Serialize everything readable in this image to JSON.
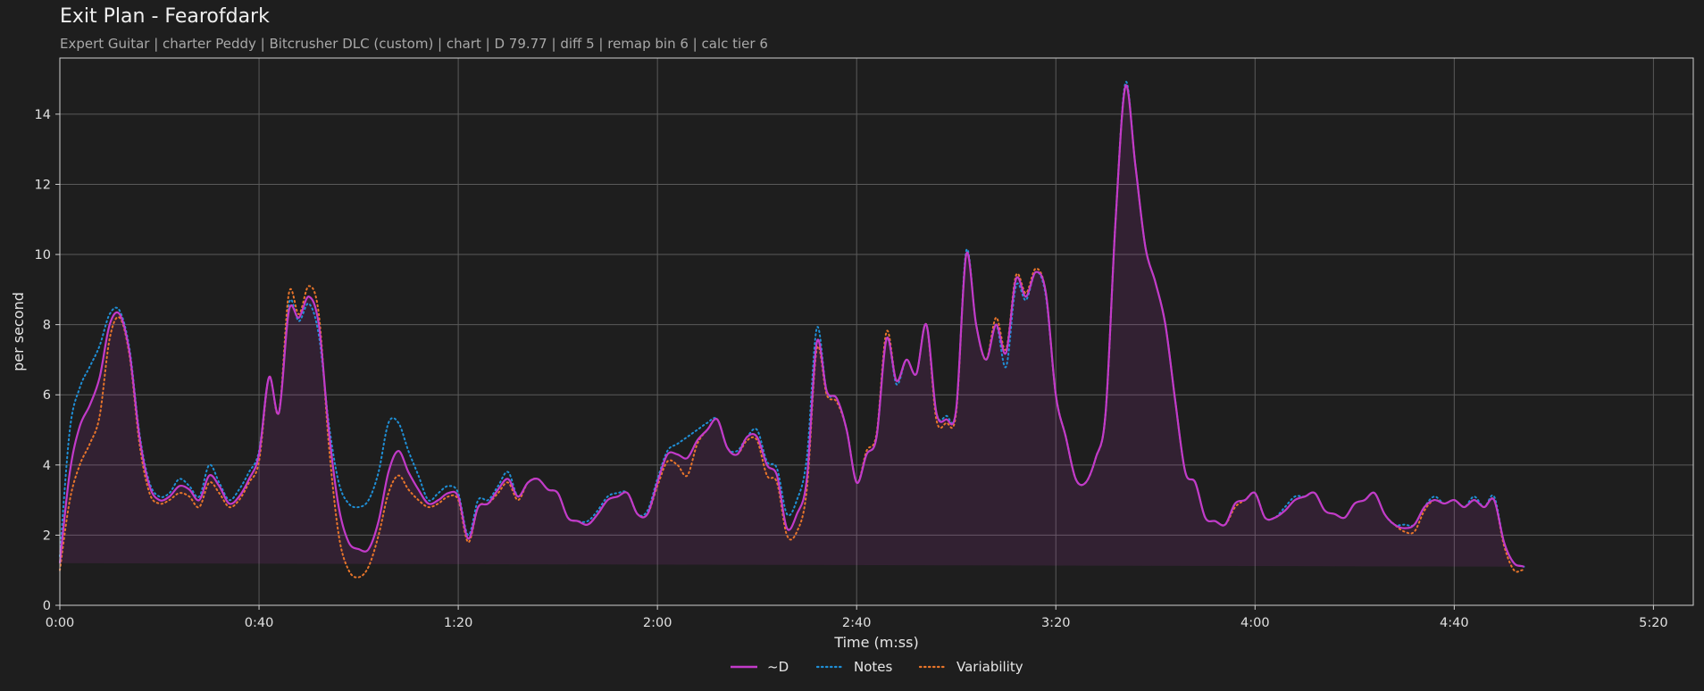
{
  "header": {
    "title": "Exit Plan - Fearofdark",
    "subtitle": "Expert Guitar  |  charter Peddy  |  Bitcrusher DLC (custom)  |  chart  |  D 79.77  |  diff 5  |  remap bin 6  |  calc tier 6"
  },
  "chart_data": {
    "type": "line",
    "title": "Exit Plan - Fearofdark",
    "xlabel": "Time (m:ss)",
    "ylabel": "per second",
    "xlim": [
      0,
      328
    ],
    "ylim": [
      0,
      15.6
    ],
    "grid": true,
    "legend_position": "bottom-center",
    "x_ticks": [
      {
        "value": 0,
        "label": "0:00"
      },
      {
        "value": 40,
        "label": "0:40"
      },
      {
        "value": 80,
        "label": "1:20"
      },
      {
        "value": 120,
        "label": "2:00"
      },
      {
        "value": 160,
        "label": "2:40"
      },
      {
        "value": 200,
        "label": "3:20"
      },
      {
        "value": 240,
        "label": "4:00"
      },
      {
        "value": 280,
        "label": "4:40"
      },
      {
        "value": 320,
        "label": "5:20"
      }
    ],
    "y_ticks": [
      {
        "value": 0,
        "label": "0"
      },
      {
        "value": 2,
        "label": "2"
      },
      {
        "value": 4,
        "label": "4"
      },
      {
        "value": 6,
        "label": "6"
      },
      {
        "value": 8,
        "label": "8"
      },
      {
        "value": 10,
        "label": "10"
      },
      {
        "value": 12,
        "label": "12"
      },
      {
        "value": 14,
        "label": "14"
      }
    ],
    "x": [
      0,
      2,
      4,
      6,
      8,
      10,
      12,
      14,
      16,
      18,
      20,
      22,
      24,
      26,
      28,
      30,
      32,
      34,
      36,
      38,
      40,
      42,
      44,
      46,
      48,
      50,
      52,
      54,
      56,
      58,
      60,
      62,
      64,
      66,
      68,
      70,
      72,
      74,
      76,
      78,
      80,
      82,
      84,
      86,
      88,
      90,
      92,
      94,
      96,
      98,
      100,
      102,
      104,
      106,
      108,
      110,
      112,
      114,
      116,
      118,
      120,
      122,
      124,
      126,
      128,
      130,
      132,
      134,
      136,
      138,
      140,
      142,
      144,
      146,
      148,
      150,
      152,
      154,
      156,
      158,
      160,
      162,
      164,
      166,
      168,
      170,
      172,
      174,
      176,
      178,
      180,
      182,
      184,
      186,
      188,
      190,
      192,
      194,
      196,
      198,
      200,
      202,
      204,
      206,
      208,
      210,
      212,
      214,
      216,
      218,
      220,
      222,
      224,
      226,
      228,
      230,
      232,
      234,
      236,
      238,
      240,
      242,
      244,
      246,
      248,
      250,
      252,
      254,
      256,
      258,
      260,
      262,
      264,
      266,
      268,
      270,
      272,
      274,
      276,
      278,
      280,
      282,
      284,
      286,
      288,
      290,
      292,
      294,
      296,
      298,
      300,
      302,
      304,
      306,
      308,
      310,
      312,
      314,
      316,
      318,
      320,
      322,
      324,
      326,
      328
    ],
    "series": [
      {
        "name": "~D",
        "color": "#c23ac9",
        "style": "solid",
        "values": [
          1.2,
          3.8,
          5.1,
          5.7,
          6.5,
          8.0,
          8.3,
          7.2,
          4.8,
          3.4,
          3.0,
          3.1,
          3.4,
          3.3,
          3.0,
          3.7,
          3.4,
          2.9,
          3.1,
          3.6,
          4.3,
          6.5,
          5.5,
          8.4,
          8.2,
          8.8,
          8.0,
          5.0,
          2.8,
          1.8,
          1.6,
          1.6,
          2.4,
          3.8,
          4.4,
          3.8,
          3.3,
          2.9,
          3.0,
          3.2,
          3.1,
          1.9,
          2.8,
          2.9,
          3.3,
          3.6,
          3.1,
          3.5,
          3.6,
          3.3,
          3.2,
          2.5,
          2.4,
          2.3,
          2.6,
          3.0,
          3.1,
          3.2,
          2.6,
          2.6,
          3.5,
          4.3,
          4.3,
          4.2,
          4.7,
          5.0,
          5.3,
          4.5,
          4.3,
          4.8,
          4.8,
          4.0,
          3.7,
          2.2,
          2.6,
          3.6,
          7.5,
          6.1,
          5.9,
          5.0,
          3.5,
          4.3,
          4.8,
          7.6,
          6.4,
          7.0,
          6.6,
          8.0,
          5.5,
          5.3,
          5.6,
          10.0,
          8.0,
          7.0,
          8.0,
          7.2,
          9.3,
          8.8,
          9.5,
          8.9,
          6.0,
          4.8,
          3.6,
          3.5,
          4.2,
          5.5,
          11.0,
          14.8,
          12.5,
          10.2,
          9.2,
          8.0,
          5.8,
          3.8,
          3.5,
          2.5,
          2.4,
          2.3,
          2.9,
          3.0,
          3.2,
          2.5,
          2.5,
          2.7,
          3.0,
          3.1,
          3.2,
          2.7,
          2.6,
          2.5,
          2.9,
          3.0,
          3.2,
          2.6,
          2.3,
          2.2,
          2.3,
          2.8,
          3.0,
          2.9,
          3.0,
          2.8,
          3.0,
          2.8,
          3.0,
          1.8,
          1.2,
          1.1,
          0.9
        ]
      },
      {
        "name": "Notes",
        "color": "#1f8fd6",
        "style": "dotted",
        "values": [
          1.4,
          5.0,
          6.2,
          6.8,
          7.4,
          8.3,
          8.4,
          7.3,
          4.9,
          3.5,
          3.1,
          3.2,
          3.6,
          3.4,
          3.1,
          4.0,
          3.5,
          3.0,
          3.3,
          3.8,
          4.4,
          6.5,
          5.5,
          8.6,
          8.1,
          8.6,
          7.7,
          5.2,
          3.5,
          2.9,
          2.8,
          3.0,
          3.8,
          5.2,
          5.2,
          4.4,
          3.7,
          3.0,
          3.2,
          3.4,
          3.2,
          2.0,
          3.0,
          3.0,
          3.4,
          3.8,
          3.1,
          3.5,
          3.6,
          3.3,
          3.2,
          2.5,
          2.4,
          2.4,
          2.7,
          3.1,
          3.2,
          3.2,
          2.6,
          2.7,
          3.6,
          4.4,
          4.6,
          4.8,
          5.0,
          5.2,
          5.3,
          4.5,
          4.4,
          4.8,
          5.0,
          4.1,
          3.9,
          2.6,
          3.0,
          4.2,
          7.9,
          6.1,
          5.9,
          5.0,
          3.5,
          4.3,
          4.8,
          7.6,
          6.3,
          7.0,
          6.6,
          8.0,
          5.5,
          5.4,
          5.6,
          10.1,
          8.0,
          7.0,
          8.0,
          6.8,
          9.1,
          8.7,
          9.5,
          8.8,
          6.0,
          4.8,
          3.6,
          3.5,
          4.2,
          5.5,
          11.0,
          14.9,
          12.5,
          10.2,
          9.2,
          8.0,
          5.8,
          3.8,
          3.5,
          2.5,
          2.4,
          2.3,
          2.9,
          3.0,
          3.2,
          2.5,
          2.5,
          2.8,
          3.1,
          3.1,
          3.2,
          2.7,
          2.6,
          2.5,
          2.9,
          3.0,
          3.2,
          2.6,
          2.3,
          2.3,
          2.3,
          2.8,
          3.1,
          2.9,
          3.0,
          2.8,
          3.1,
          2.8,
          3.1,
          1.8,
          1.2,
          1.1,
          0.9
        ]
      },
      {
        "name": "Variability",
        "color": "#e8752a",
        "style": "dotted",
        "values": [
          1.0,
          3.0,
          4.0,
          4.6,
          5.4,
          7.6,
          8.2,
          7.1,
          4.6,
          3.2,
          2.9,
          3.0,
          3.2,
          3.1,
          2.8,
          3.5,
          3.2,
          2.8,
          3.0,
          3.5,
          4.1,
          6.5,
          5.5,
          8.9,
          8.3,
          9.1,
          8.3,
          4.6,
          2.0,
          1.0,
          0.8,
          1.1,
          2.0,
          3.2,
          3.7,
          3.3,
          3.0,
          2.8,
          2.9,
          3.1,
          3.0,
          1.8,
          2.8,
          2.9,
          3.2,
          3.5,
          3.0,
          3.5,
          3.6,
          3.3,
          3.2,
          2.5,
          2.4,
          2.3,
          2.6,
          3.0,
          3.1,
          3.2,
          2.6,
          2.6,
          3.4,
          4.1,
          4.0,
          3.7,
          4.6,
          5.0,
          5.3,
          4.5,
          4.3,
          4.7,
          4.7,
          3.7,
          3.5,
          2.0,
          2.1,
          3.3,
          7.3,
          6.0,
          5.8,
          5.0,
          3.5,
          4.4,
          4.9,
          7.8,
          6.4,
          7.0,
          6.6,
          8.0,
          5.3,
          5.2,
          5.5,
          10.0,
          8.0,
          7.0,
          8.2,
          7.3,
          9.4,
          8.9,
          9.6,
          8.9,
          6.0,
          4.8,
          3.6,
          3.5,
          4.2,
          5.5,
          11.0,
          14.8,
          12.5,
          10.2,
          9.2,
          8.0,
          5.8,
          3.8,
          3.5,
          2.5,
          2.4,
          2.3,
          2.8,
          3.0,
          3.2,
          2.5,
          2.5,
          2.7,
          3.0,
          3.1,
          3.2,
          2.7,
          2.6,
          2.5,
          2.9,
          3.0,
          3.2,
          2.6,
          2.3,
          2.1,
          2.1,
          2.7,
          3.0,
          2.9,
          3.0,
          2.8,
          3.0,
          2.8,
          3.0,
          1.7,
          1.0,
          1.0,
          0.8
        ]
      }
    ]
  }
}
